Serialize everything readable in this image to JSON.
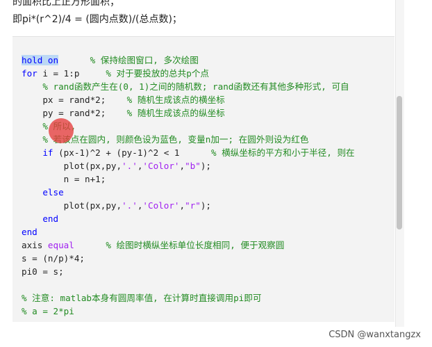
{
  "article": {
    "top_fragment": "的面积比上正方形面积；",
    "formula": "即pi*(r^2)/4 = (圆内点数)/(总点数)；"
  },
  "code": {
    "lines": [
      [
        {
          "t": "hold on",
          "c": "kw hl"
        },
        {
          "t": "      "
        },
        {
          "t": "% 保持绘图窗口, 多次绘图",
          "c": "cm"
        }
      ],
      [
        {
          "t": "for",
          "c": "kw"
        },
        {
          "t": " i = 1:p     "
        },
        {
          "t": "% 对于要投放的总共p个点",
          "c": "cm"
        }
      ],
      [
        {
          "t": "    "
        },
        {
          "t": "% rand函数产生在(0, 1)之间的随机数; rand函数还有其他多种形式, 可自",
          "c": "cm"
        }
      ],
      [
        {
          "t": "    px = rand*2;    "
        },
        {
          "t": "% 随机生成该点的横坐标",
          "c": "cm"
        }
      ],
      [
        {
          "t": "    py = rand*2;    "
        },
        {
          "t": "% 随机生成该点的纵坐标",
          "c": "cm"
        }
      ],
      [
        {
          "t": "    "
        },
        {
          "t": "% 所以,",
          "c": "cm"
        }
      ],
      [
        {
          "t": "    "
        },
        {
          "t": "% 若该点在圆内, 则颜色设为蓝色, 变量n加一; 在圆外则设为红色",
          "c": "cm"
        }
      ],
      [
        {
          "t": "    "
        },
        {
          "t": "if",
          "c": "kw"
        },
        {
          "t": " (px-1)^2 + (py-1)^2 < 1      "
        },
        {
          "t": "% 横纵坐标的平方和小于半径, 则在",
          "c": "cm"
        }
      ],
      [
        {
          "t": "        plot(px,py,"
        },
        {
          "t": "'.'",
          "c": "st"
        },
        {
          "t": ","
        },
        {
          "t": "'Color'",
          "c": "st"
        },
        {
          "t": ","
        },
        {
          "t": "\"b\"",
          "c": "st"
        },
        {
          "t": ");"
        }
      ],
      [
        {
          "t": "        n = n+1;"
        }
      ],
      [
        {
          "t": "    "
        },
        {
          "t": "else",
          "c": "kw"
        }
      ],
      [
        {
          "t": "        plot(px,py,"
        },
        {
          "t": "'.'",
          "c": "st"
        },
        {
          "t": ","
        },
        {
          "t": "'Color'",
          "c": "st"
        },
        {
          "t": ","
        },
        {
          "t": "\"r\"",
          "c": "st"
        },
        {
          "t": ");"
        }
      ],
      [
        {
          "t": "    "
        },
        {
          "t": "end",
          "c": "kw"
        }
      ],
      [
        {
          "t": "end",
          "c": "kw"
        }
      ],
      [
        {
          "t": "axis "
        },
        {
          "t": "equal",
          "c": "st"
        },
        {
          "t": "      "
        },
        {
          "t": "% 绘图时横纵坐标单位长度相同, 便于观察圆",
          "c": "cm"
        }
      ],
      [
        {
          "t": "s = (n/p)*4;"
        }
      ],
      [
        {
          "t": "pi0 = s;"
        }
      ],
      [
        {
          "t": ""
        }
      ],
      [
        {
          "t": "% 注意: matlab本身有圆周率值, 在计算时直接调用pi即可",
          "c": "cm"
        }
      ],
      [
        {
          "t": "% a = 2*pi",
          "c": "cm"
        }
      ]
    ]
  },
  "colors": {
    "keyword": "#0000ff",
    "comment": "#228b22",
    "string": "#a020f0",
    "selection": "#bcd8f5",
    "code_background": "#f3f3f3"
  },
  "watermark": "CSDN @wanxtangzx"
}
